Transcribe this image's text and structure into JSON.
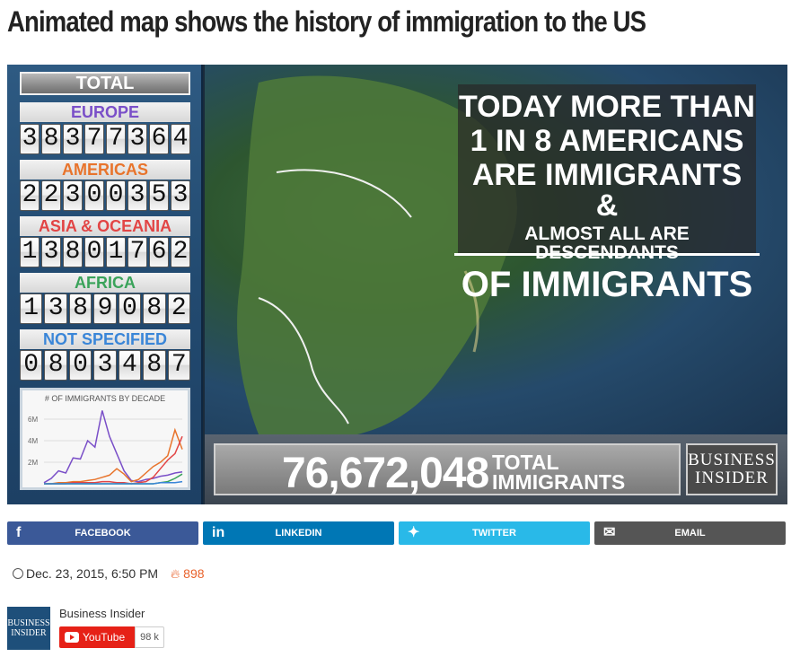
{
  "headline": "Animated map shows the history of immigration to the US",
  "video": {
    "total_label": "TOTAL",
    "regions": [
      {
        "label": "EUROPE",
        "digits": "38377364",
        "color": "#7a4fc8"
      },
      {
        "label": "AMERICAS",
        "digits": "22300353",
        "color": "#e8742c"
      },
      {
        "label": "ASIA & OCEANIA",
        "digits": "13801762",
        "color": "#e24545"
      },
      {
        "label": "AFRICA",
        "digits": "1389082",
        "color": "#3aa35a"
      },
      {
        "label": "NOT SPECIFIED",
        "digits": "0803487",
        "color": "#3a86d8"
      }
    ],
    "overlay_lines": [
      "TODAY MORE THAN",
      "1 IN 8 AMERICANS",
      "ARE IMMIGRANTS &",
      "ALMOST ALL ARE DESCENDANTS",
      "OF IMMIGRANTS"
    ],
    "total_number": "76,672,048",
    "total_word_1": "TOTAL",
    "total_word_2": "IMMIGRANTS",
    "logo_line1": "BUSINESS",
    "logo_line2": "INSIDER"
  },
  "chart_data": {
    "type": "line",
    "title": "# OF IMMIGRANTS BY DECADE",
    "xlabel": "",
    "ylabel": "",
    "yticks": [
      "2M",
      "4M",
      "6M"
    ],
    "ylim": [
      0,
      7
    ],
    "x": [
      0,
      1,
      2,
      3,
      4,
      5,
      6,
      7,
      8,
      9,
      10,
      11,
      12,
      13,
      14,
      15,
      16,
      17,
      18,
      19
    ],
    "series": [
      {
        "color": "#7a4fc8",
        "values": [
          0.1,
          0.5,
          1.2,
          1.0,
          2.4,
          2.3,
          4.0,
          3.4,
          6.8,
          4.4,
          2.8,
          1.2,
          0.3,
          0.2,
          0.4,
          0.5,
          0.7,
          0.8,
          1.0,
          1.1
        ]
      },
      {
        "color": "#e8742c",
        "values": [
          0.0,
          0.0,
          0.1,
          0.1,
          0.2,
          0.2,
          0.3,
          0.4,
          0.6,
          0.8,
          1.4,
          0.9,
          0.2,
          0.4,
          1.0,
          1.6,
          2.0,
          2.6,
          5.0,
          3.2
        ]
      },
      {
        "color": "#e24545",
        "values": [
          0.0,
          0.0,
          0.0,
          0.0,
          0.1,
          0.1,
          0.1,
          0.1,
          0.2,
          0.2,
          0.1,
          0.1,
          0.0,
          0.1,
          0.2,
          0.6,
          1.4,
          2.2,
          2.8,
          4.4
        ]
      },
      {
        "color": "#3aa35a",
        "values": [
          0.0,
          0.0,
          0.0,
          0.0,
          0.0,
          0.0,
          0.0,
          0.0,
          0.0,
          0.0,
          0.0,
          0.0,
          0.0,
          0.0,
          0.0,
          0.0,
          0.1,
          0.2,
          0.5,
          0.9
        ]
      },
      {
        "color": "#3a86d8",
        "values": [
          0.0,
          0.0,
          0.0,
          0.0,
          0.0,
          0.0,
          0.0,
          0.0,
          0.0,
          0.0,
          0.0,
          0.0,
          0.0,
          0.0,
          0.0,
          0.0,
          0.1,
          0.1,
          0.1,
          0.2
        ]
      }
    ]
  },
  "share": {
    "facebook": "FACEBOOK",
    "linkedin": "LINKEDIN",
    "twitter": "TWITTER",
    "email": "EMAIL",
    "colors": {
      "facebook": "#3b5998",
      "linkedin": "#0077b5",
      "twitter": "#29b9e8",
      "email": "#555555"
    }
  },
  "meta": {
    "date": "Dec. 23, 2015, 6:50 PM",
    "views": "898",
    "accent": "#e8622c"
  },
  "channel": {
    "name": "Business Insider",
    "logo_line1": "BUSINESS",
    "logo_line2": "INSIDER",
    "youtube_label": "YouTube",
    "subscriber_count": "98 k"
  }
}
